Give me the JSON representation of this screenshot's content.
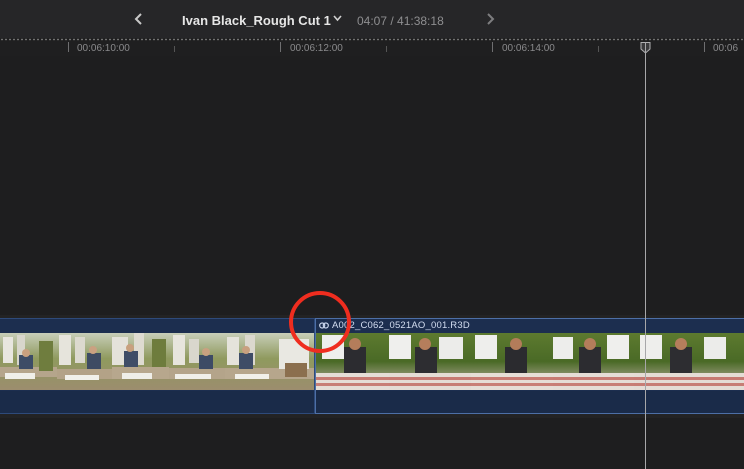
{
  "toolbar": {
    "back_icon": "chevron-left-icon",
    "forward_icon": "chevron-right-icon",
    "project_title": "Ivan Black_Rough Cut 1",
    "title_menu_icon": "chevron-down-icon",
    "timecode": "04:07 / 41:38:18"
  },
  "ruler": {
    "labels": [
      "00:06:10:00",
      "00:06:12:00",
      "00:06:14:00",
      "00:06"
    ]
  },
  "clips": [
    {
      "name": "",
      "selected": false
    },
    {
      "name": "A002_C062_0521AO_001.R3D",
      "selected": true,
      "icon": "link-icon"
    }
  ],
  "colors": {
    "annotation": "#ef2d1f",
    "clip_fill": "#1c2e4f",
    "playhead": "#a7a7a9"
  }
}
